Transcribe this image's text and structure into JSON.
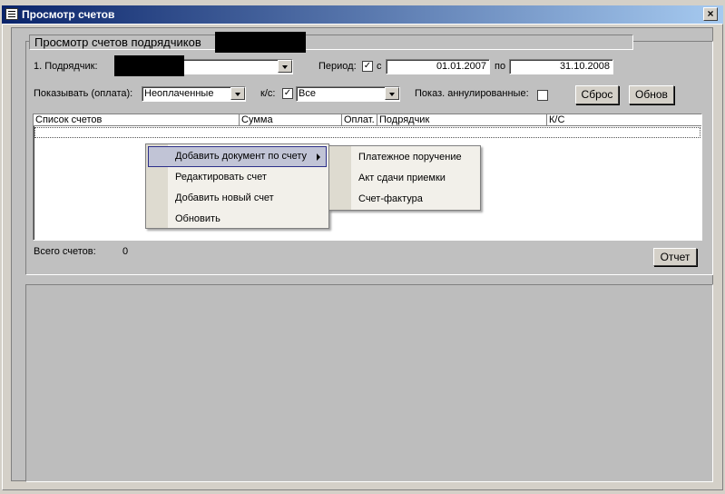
{
  "window": {
    "title": "Просмотр счетов",
    "close_glyph": "×"
  },
  "group": {
    "title": "Просмотр счетов подрядчиков"
  },
  "filters": {
    "contractor_label": "1. Подрядчик:",
    "period_label": "Период:",
    "period_checked": true,
    "from_label": "с",
    "from_value": "01.01.2007",
    "to_label": "по",
    "to_value": "31.10.2008",
    "show_label": "Показывать (оплата):",
    "show_value": "Неоплаченные",
    "ks_label": "к/с:",
    "ks_checked": true,
    "ks_value": "Все",
    "annulled_label": "Показ. аннулированные:",
    "annulled_checked": false,
    "reset_button": "Сброс",
    "refresh_button": "Обнов"
  },
  "list": {
    "columns": [
      "Список счетов",
      "Сумма",
      "Оплат.",
      "Подрядчик",
      "К/С"
    ],
    "rows": []
  },
  "footer": {
    "total_label": "Всего счетов:",
    "total_value": "0",
    "report_button": "Отчет"
  },
  "context_menu": {
    "items": [
      {
        "label": "Добавить документ по счету",
        "has_submenu": true,
        "highlighted": true
      },
      {
        "label": "Редактировать счет"
      },
      {
        "label": "Добавить новый счет"
      },
      {
        "label": "Обновить"
      }
    ],
    "submenu": [
      {
        "label": "Платежное поручение"
      },
      {
        "label": "Акт сдачи приемки"
      },
      {
        "label": "Счет-фактура"
      }
    ]
  }
}
